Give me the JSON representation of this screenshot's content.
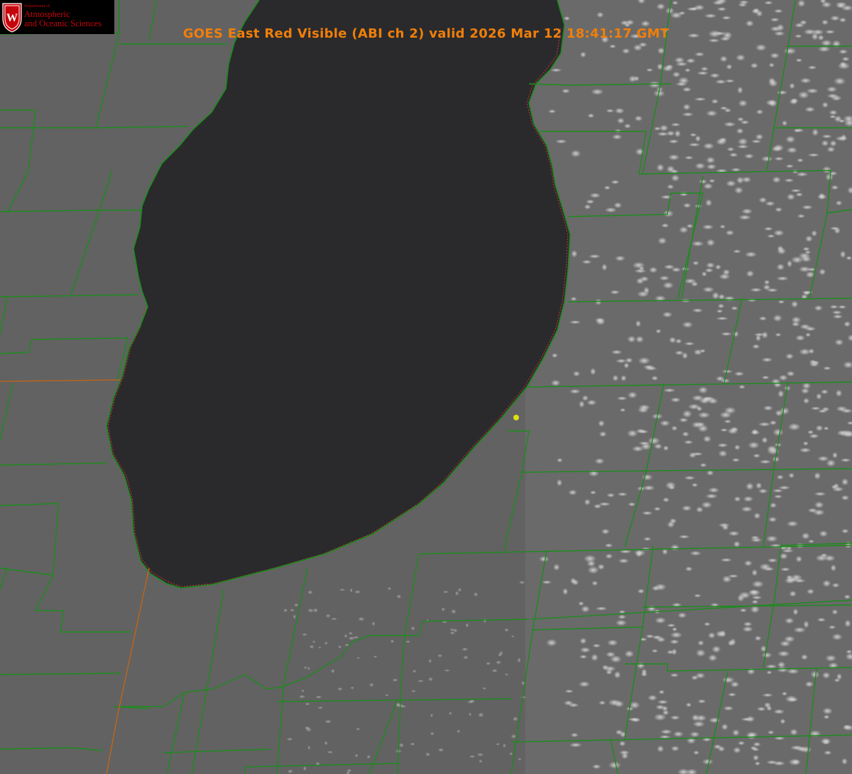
{
  "title": "GOES East Red Visible (ABI ch 2) valid 2026 Mar 12 18:41:17 GMT",
  "logo": {
    "dept": "Department of",
    "line1": "Atmospheric",
    "line2": "and Oceanic Sciences",
    "crest_letter": "W"
  },
  "colors": {
    "title": "#f07f0a",
    "county_lines": "#1c8c1c",
    "shoreline": "#d0303a",
    "state_line": "#c86410",
    "marker": "#dede10",
    "lake": "#2a2a2c",
    "land": "#646464",
    "clouds": "#cfcfcf"
  }
}
